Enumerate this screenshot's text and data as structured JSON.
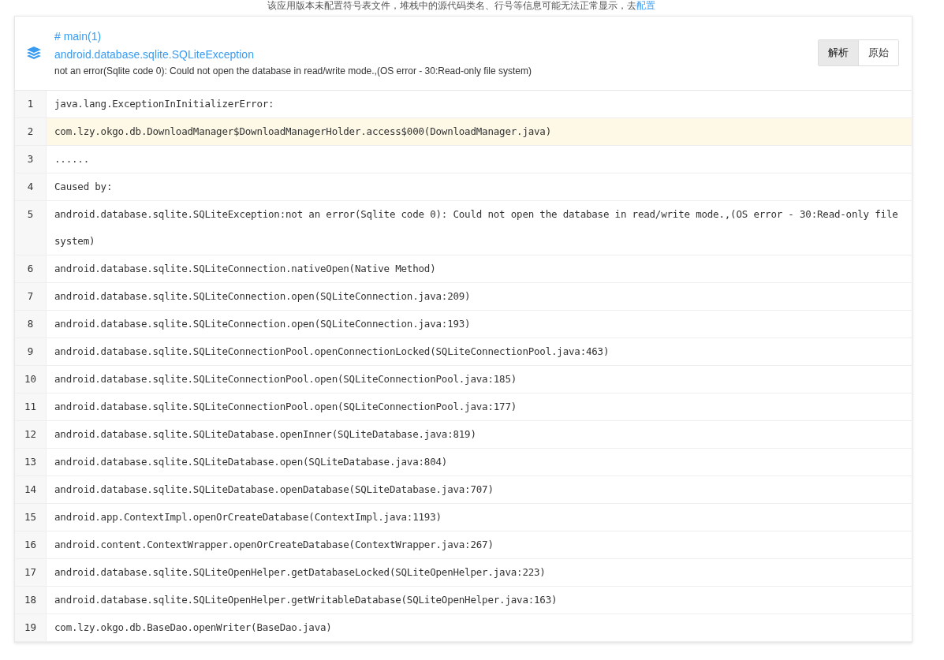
{
  "notice": {
    "text": "该应用版本未配置符号表文件，堆栈中的源代码类名、行号等信息可能无法正常显示，去",
    "link": "配置"
  },
  "header": {
    "thread": "# main(1)",
    "exception": "android.database.sqlite.SQLiteException",
    "message": "not an error(Sqlite code 0): Could not open the database in read/write mode.,(OS error - 30:Read-only file system)",
    "view_tabs": [
      {
        "label": "解析",
        "selected": true
      },
      {
        "label": "原始",
        "selected": false
      }
    ]
  },
  "stack": [
    {
      "number": "1",
      "text": "java.lang.ExceptionInInitializerError:",
      "highlighted": false
    },
    {
      "number": "2",
      "text": "com.lzy.okgo.db.DownloadManager$DownloadManagerHolder.access$000(DownloadManager.java)",
      "highlighted": true
    },
    {
      "number": "3",
      "text": "......",
      "highlighted": false
    },
    {
      "number": "4",
      "text": "Caused by:",
      "highlighted": false
    },
    {
      "number": "5",
      "text": "android.database.sqlite.SQLiteException:not an error(Sqlite code 0): Could not open the database in read/write mode.,(OS error - 30:Read-only file system)",
      "highlighted": false
    },
    {
      "number": "6",
      "text": "android.database.sqlite.SQLiteConnection.nativeOpen(Native Method)",
      "highlighted": false
    },
    {
      "number": "7",
      "text": "android.database.sqlite.SQLiteConnection.open(SQLiteConnection.java:209)",
      "highlighted": false
    },
    {
      "number": "8",
      "text": "android.database.sqlite.SQLiteConnection.open(SQLiteConnection.java:193)",
      "highlighted": false
    },
    {
      "number": "9",
      "text": "android.database.sqlite.SQLiteConnectionPool.openConnectionLocked(SQLiteConnectionPool.java:463)",
      "highlighted": false
    },
    {
      "number": "10",
      "text": "android.database.sqlite.SQLiteConnectionPool.open(SQLiteConnectionPool.java:185)",
      "highlighted": false
    },
    {
      "number": "11",
      "text": "android.database.sqlite.SQLiteConnectionPool.open(SQLiteConnectionPool.java:177)",
      "highlighted": false
    },
    {
      "number": "12",
      "text": "android.database.sqlite.SQLiteDatabase.openInner(SQLiteDatabase.java:819)",
      "highlighted": false
    },
    {
      "number": "13",
      "text": "android.database.sqlite.SQLiteDatabase.open(SQLiteDatabase.java:804)",
      "highlighted": false
    },
    {
      "number": "14",
      "text": "android.database.sqlite.SQLiteDatabase.openDatabase(SQLiteDatabase.java:707)",
      "highlighted": false
    },
    {
      "number": "15",
      "text": "android.app.ContextImpl.openOrCreateDatabase(ContextImpl.java:1193)",
      "highlighted": false
    },
    {
      "number": "16",
      "text": "android.content.ContextWrapper.openOrCreateDatabase(ContextWrapper.java:267)",
      "highlighted": false
    },
    {
      "number": "17",
      "text": "android.database.sqlite.SQLiteOpenHelper.getDatabaseLocked(SQLiteOpenHelper.java:223)",
      "highlighted": false
    },
    {
      "number": "18",
      "text": "android.database.sqlite.SQLiteOpenHelper.getWritableDatabase(SQLiteOpenHelper.java:163)",
      "highlighted": false
    },
    {
      "number": "19",
      "text": "com.lzy.okgo.db.BaseDao.openWriter(BaseDao.java)",
      "highlighted": false
    }
  ]
}
